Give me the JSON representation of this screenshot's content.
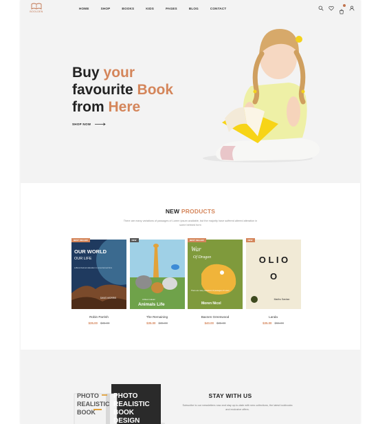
{
  "header": {
    "logo_text": "BOOLDEN",
    "nav": [
      "HOME",
      "SHOP",
      "BOOKS",
      "KIDS",
      "PAGES",
      "BLOG",
      "CONTACT"
    ],
    "icons": [
      "search-icon",
      "heart-icon",
      "cart-icon",
      "user-icon"
    ]
  },
  "hero": {
    "line1_a": "Buy ",
    "line1_b": "your",
    "line2_a": "favourite ",
    "line2_b": "Book",
    "line3_a": "from ",
    "line3_b": "Here",
    "cta": "SHOP NOW"
  },
  "products": {
    "title_a": "NEW ",
    "title_b": "PRODUCTS",
    "description": "There are many variations of passages of Lorem Ipsum available, but the majority have suffered altered alteration in some betmed form",
    "items": [
      {
        "badge": "BEST SELLER",
        "badge_color": "#d4855a",
        "cover_title": "OUR WORLD",
        "cover_sub": "OUR LIFE",
        "cover_tagline": "suffered betmed alteration in some betmed form",
        "cover_author": "DAVID MORRIS",
        "name": "Robin Parrish",
        "price": "$35.00",
        "old_price": "$35.00"
      },
      {
        "badge": "NEW",
        "badge_color": "#555555",
        "cover_author": "Arifean Hasan",
        "cover_title": "Animals Life",
        "name": "The Remaining",
        "price": "$35.00",
        "old_price": "$35.00"
      },
      {
        "badge": "BEST SELLER",
        "badge_color": "#d4855a",
        "cover_title": "War",
        "cover_sub": "Of Dragon",
        "cover_tagline": "There are many variations of passages of Lorem",
        "cover_author": "Moren Nicol",
        "name": "Baxnen Greenwood",
        "price": "$40.00",
        "old_price": "$35.00"
      },
      {
        "badge": "NEW",
        "badge_color": "#d4855a",
        "cover_title": "O L I O",
        "cover_author": "Madhu Sashan",
        "name": "Landa",
        "price": "$35.00",
        "old_price": "$55.00"
      }
    ]
  },
  "newsletter": {
    "title": "STAY WITH US",
    "text": "Subscribe to our newsletters now and stay up-to-date with new collections, the latest lookbooks and exclusive offers.",
    "book_front": [
      "PHOTO",
      "REALISTIC",
      "BOOK"
    ],
    "book_back": [
      "PHOTO",
      "REALISTIC",
      "BOOK",
      "DESIGN"
    ]
  }
}
